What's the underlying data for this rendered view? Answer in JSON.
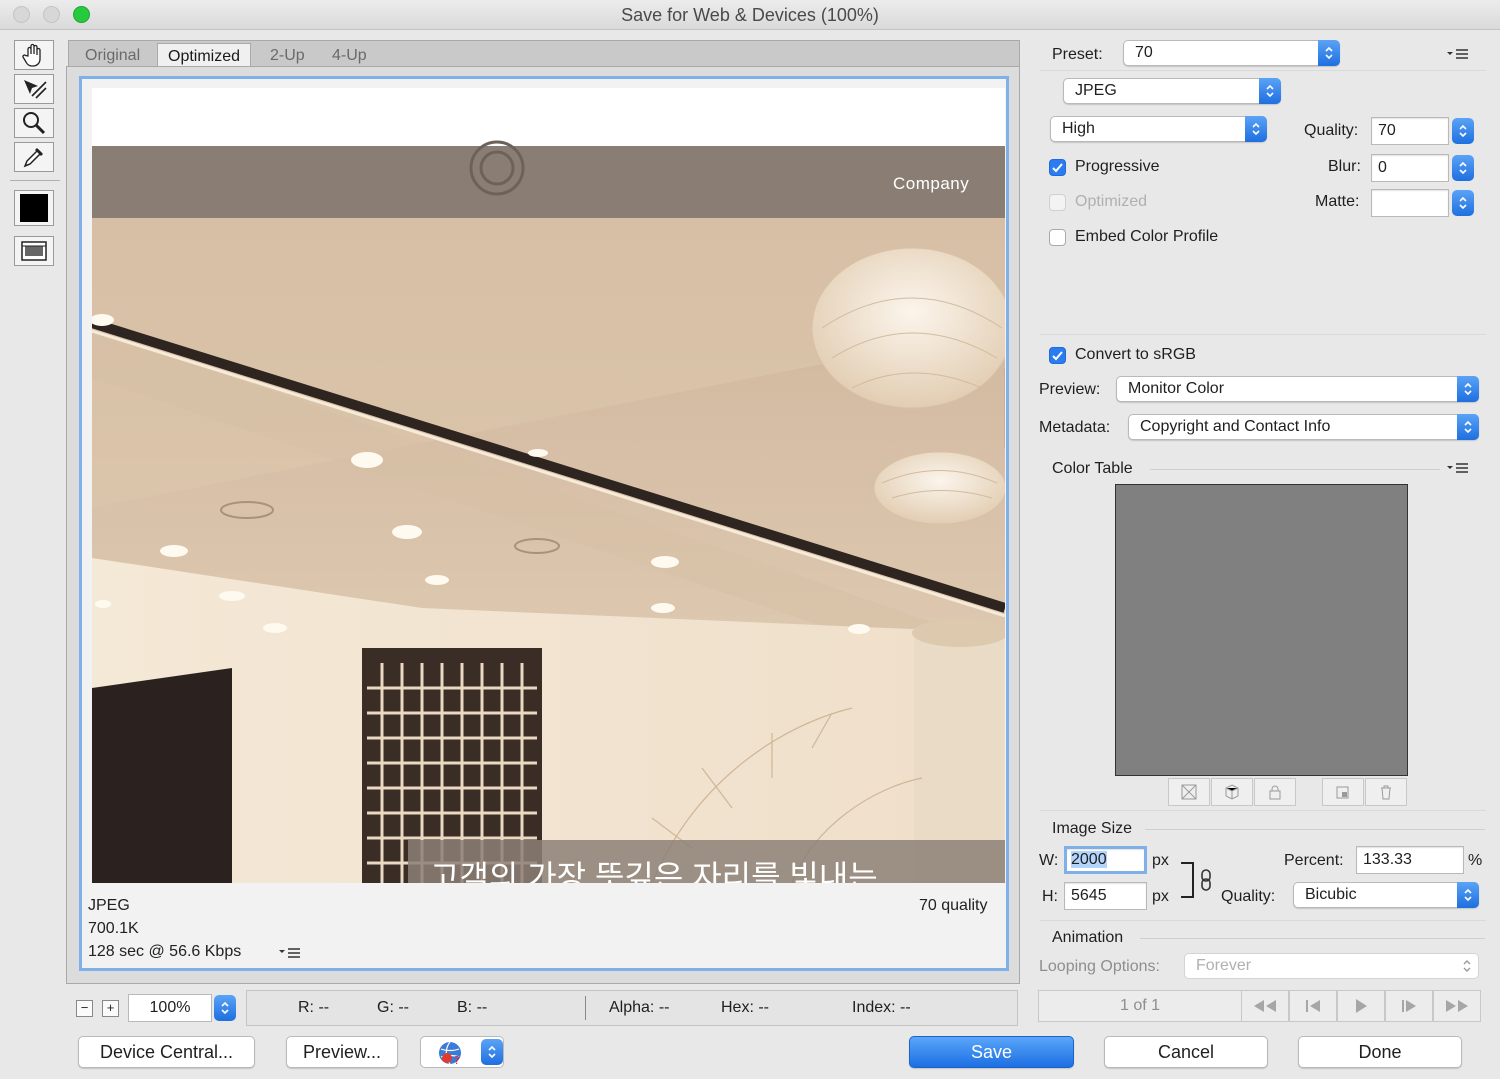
{
  "window": {
    "title": "Save for Web & Devices (100%)"
  },
  "tabs": [
    "Original",
    "Optimized",
    "2-Up",
    "4-Up"
  ],
  "preview": {
    "overlay_label": "Company",
    "banner_text": "고객의 가장 뜻깊은 자리를 빛내는",
    "format": "JPEG",
    "size": "700.1K",
    "download_time": "128 sec @ 56.6 Kbps",
    "quality_text": "70 quality"
  },
  "statusbar": {
    "zoom": "100%",
    "r": "R: --",
    "g": "G: --",
    "b": "B: --",
    "alpha": "Alpha: --",
    "hex": "Hex: --",
    "index": "Index: --",
    "zoom_out": "−",
    "zoom_in": "+"
  },
  "settings": {
    "preset_label": "Preset:",
    "preset_value": "70",
    "format_value": "JPEG",
    "compression_value": "High",
    "quality_label": "Quality:",
    "quality_value": "70",
    "blur_label": "Blur:",
    "blur_value": "0",
    "matte_label": "Matte:",
    "progressive_label": "Progressive",
    "progressive_checked": true,
    "optimized_label": "Optimized",
    "optimized_checked": false,
    "embed_label": "Embed Color Profile",
    "embed_checked": false,
    "convert_label": "Convert to sRGB",
    "convert_checked": true,
    "preview_label": "Preview:",
    "preview_value": "Monitor Color",
    "metadata_label": "Metadata:",
    "metadata_value": "Copyright and Contact Info"
  },
  "color_table": {
    "title": "Color Table",
    "swatch_color": "#808080"
  },
  "image_size": {
    "title": "Image Size",
    "w_label": "W:",
    "w_value": "2000",
    "h_label": "H:",
    "h_value": "5645",
    "unit": "px",
    "percent_label": "Percent:",
    "percent_value": "133.33",
    "percent_unit": "%",
    "quality_label": "Quality:",
    "quality_value": "Bicubic"
  },
  "animation": {
    "title": "Animation",
    "looping_label": "Looping Options:",
    "looping_value": "Forever",
    "frame_counter": "1 of 1"
  },
  "buttons": {
    "device_central": "Device Central...",
    "preview": "Preview...",
    "save": "Save",
    "cancel": "Cancel",
    "done": "Done"
  },
  "colors": {
    "accent": "#2a7cf0",
    "selection_border": "#7fb0ea"
  }
}
